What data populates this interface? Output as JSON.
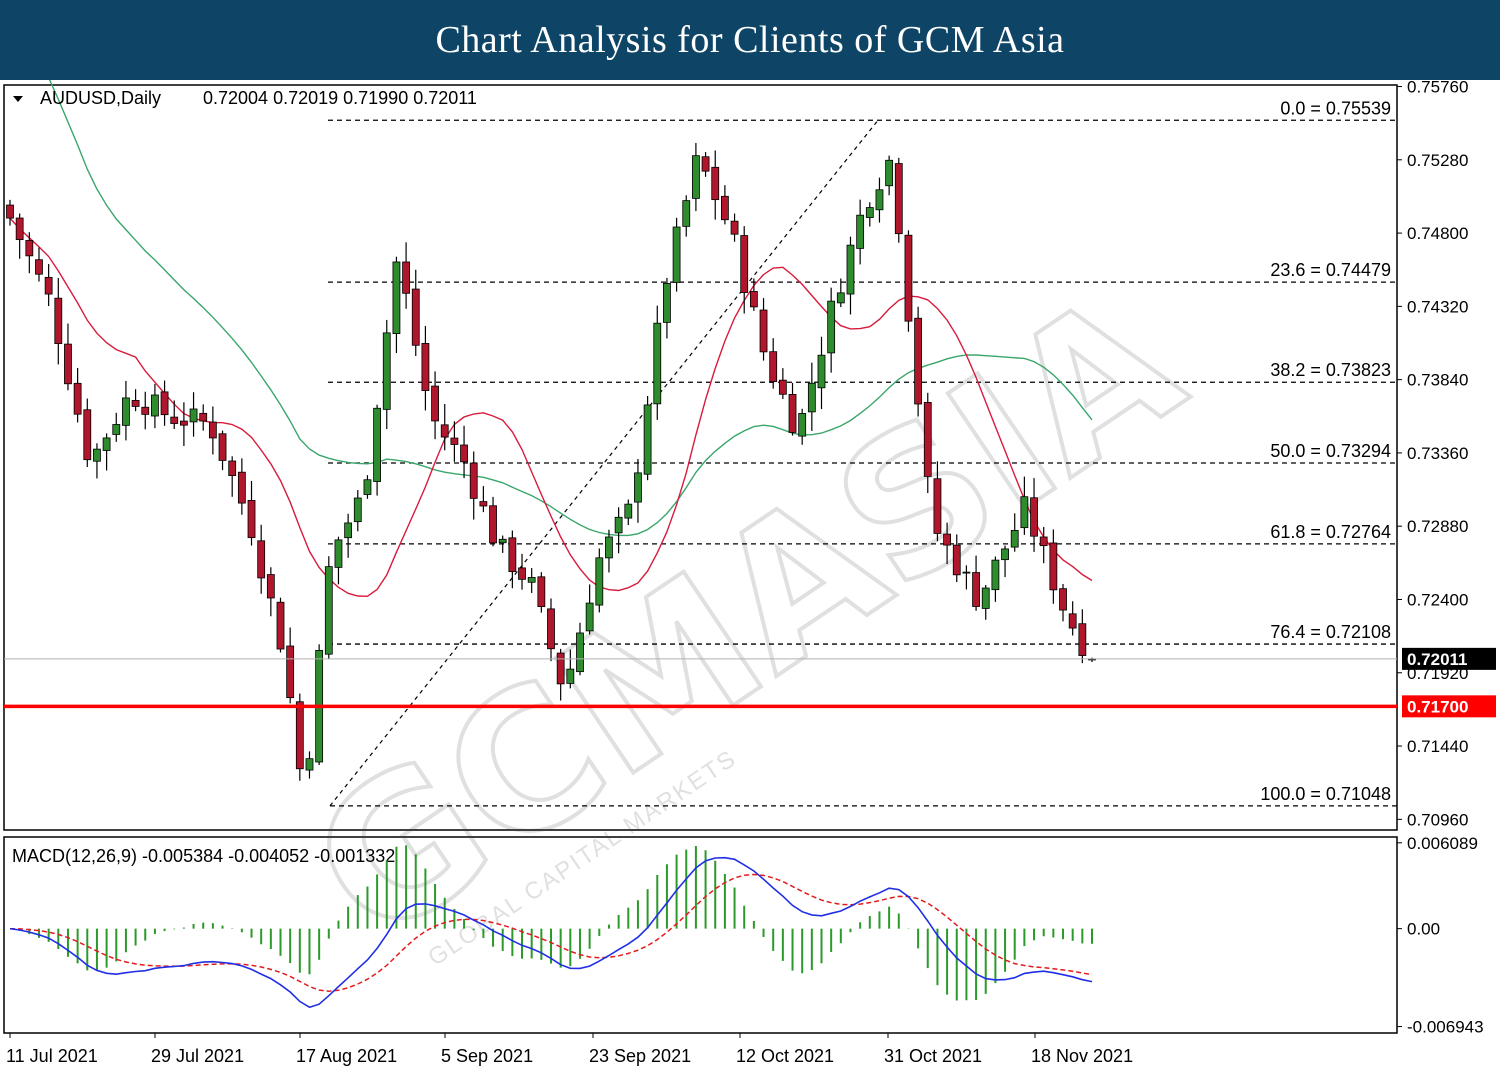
{
  "header": {
    "title": "Chart Analysis for Clients of GCM Asia"
  },
  "chart_data": {
    "type": "candlestick",
    "symbol_label": "AUDUSD,Daily",
    "ohlc_label": "0.72004 0.72019 0.71990 0.72011",
    "price_axis": {
      "range": [
        0.7089,
        0.7577
      ],
      "ticks": [
        "0.75760",
        "0.75280",
        "0.74800",
        "0.74320",
        "0.73840",
        "0.73360",
        "0.72880",
        "0.72400",
        "0.71920",
        "0.71440",
        "0.70960"
      ]
    },
    "current_price": {
      "value": 0.72011,
      "label": "0.72011"
    },
    "support_line": {
      "value": 0.717,
      "label": "0.71700",
      "color": "#ff0000"
    },
    "fibonacci": {
      "levels": [
        {
          "value": 0.75539,
          "label": "0.0 = 0.75539"
        },
        {
          "value": 0.74479,
          "label": "23.6 = 0.74479"
        },
        {
          "value": 0.73823,
          "label": "38.2 = 0.73823"
        },
        {
          "value": 0.73294,
          "label": "50.0 = 0.73294"
        },
        {
          "value": 0.72764,
          "label": "61.8 = 0.72764"
        },
        {
          "value": 0.72108,
          "label": "76.4 = 0.72108"
        },
        {
          "value": 0.71048,
          "label": "100.0 = 0.71048"
        }
      ]
    },
    "date_labels": [
      "11 Jul 2021",
      "29 Jul 2021",
      "17 Aug 2021",
      "5 Sep 2021",
      "23 Sep 2021",
      "12 Oct 2021",
      "31 Oct 2021",
      "18 Nov 2021"
    ],
    "macd": {
      "label": "MACD(12,26,9) -0.005384 -0.004052 -0.001332",
      "range": [
        -0.0074,
        0.0065
      ],
      "ticks": [
        "0.006089",
        "0.00",
        "-0.006943"
      ]
    },
    "watermark": {
      "text": "GCMASIA",
      "subtext": "GLOBAL CAPITAL MARKETS"
    },
    "colors": {
      "bull": "#2e8b2e",
      "bear": "#b0172d",
      "ma_fast": "#d81b3c",
      "ma_slow": "#3aa66b",
      "macd": "#1f2fe6",
      "signal": "#e21c1c",
      "histogram": "#2b9a2b"
    }
  }
}
